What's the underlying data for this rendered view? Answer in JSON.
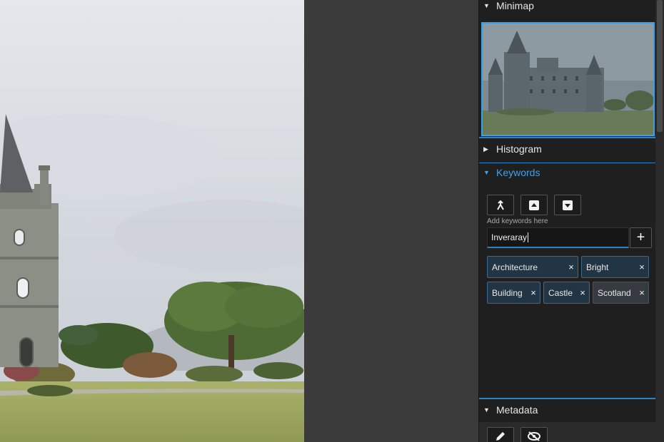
{
  "panel": {
    "minimap": {
      "title": "Minimap",
      "expanded": true
    },
    "histogram": {
      "title": "Histogram",
      "expanded": false
    },
    "keywords": {
      "title": "Keywords",
      "expanded": true,
      "tools": [
        "merge-icon",
        "import-icon",
        "export-icon"
      ],
      "hint": "Add keywords here",
      "input_value": "Inveraray",
      "add_label": "+",
      "chips": [
        {
          "label": "Architecture",
          "remove": "×"
        },
        {
          "label": "Bright",
          "remove": "×"
        },
        {
          "label": "Building",
          "remove": "×"
        },
        {
          "label": "Castle",
          "remove": "×"
        },
        {
          "label": "Scotland",
          "remove": "×"
        }
      ]
    },
    "metadata": {
      "title": "Metadata",
      "expanded": true,
      "tools": [
        "pencil-icon",
        "eye-off-icon"
      ]
    }
  },
  "colors": {
    "accent": "#43a0ea",
    "panel_bg": "#1f1f1f",
    "chip_bg": "#213545",
    "chip_grey_bg": "#353b40",
    "canvas_bg": "#3b3b3b"
  }
}
